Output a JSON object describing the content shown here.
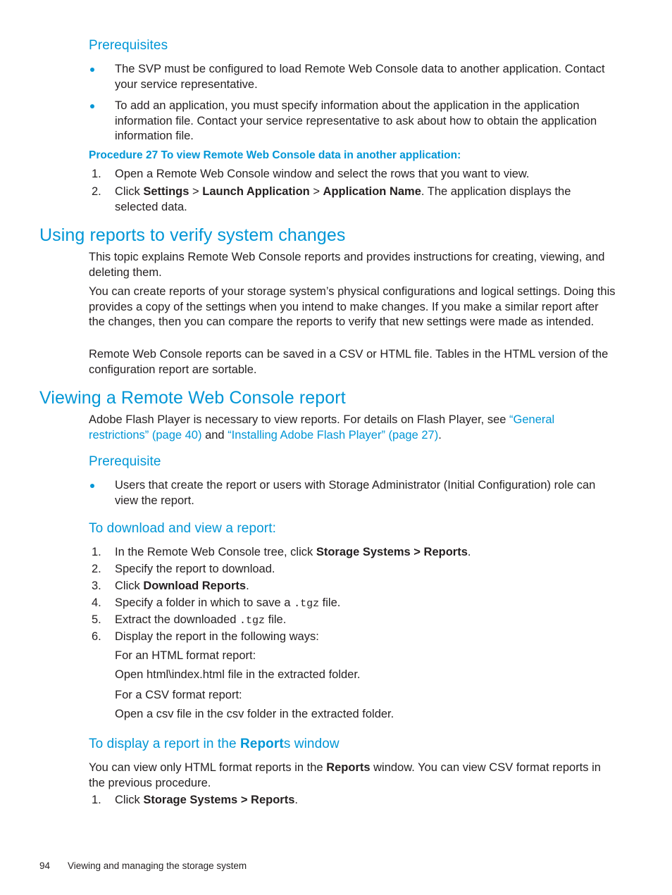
{
  "page": {
    "number": "94",
    "footer_title": "Viewing and managing the storage system"
  },
  "colors": {
    "heading_blue": "#0096d6",
    "body_text": "#231f20",
    "bullet": "#0096d6"
  },
  "sections": {
    "prerequisites_heading": "Prerequisites",
    "prereq_bullets": [
      "The SVP must be configured to load Remote Web Console data to another application. Contact your service representative.",
      "To add an application, you must specify information about the application in the application information file. Contact your service representative to ask about how to obtain the application information file."
    ],
    "procedure27_heading": "Procedure 27 To view Remote Web Console data in another application:",
    "procedure27_steps": [
      {
        "num": "1.",
        "parts": [
          {
            "t": "Open a Remote Web Console window and select the rows that you want to view.",
            "b": false
          }
        ]
      },
      {
        "num": "2.",
        "parts": [
          {
            "t": "Click ",
            "b": false
          },
          {
            "t": "Settings",
            "b": true
          },
          {
            "t": " > ",
            "b": false
          },
          {
            "t": "Launch Application",
            "b": true
          },
          {
            "t": " > ",
            "b": false
          },
          {
            "t": "Application Name",
            "b": true
          },
          {
            "t": ". The application displays the selected data.",
            "b": false
          }
        ]
      }
    ],
    "using_reports_heading": "Using reports to verify system changes",
    "using_reports_paras": [
      "This topic explains Remote Web Console reports and provides instructions for creating, viewing, and deleting them.",
      "You can create reports of your storage system’s physical configurations and logical settings. Doing this provides a copy of the settings when you intend to make changes. If you make a similar report after the changes, then you can compare the reports to verify that new settings were made as intended.",
      "Remote Web Console reports can be saved in a CSV or HTML file. Tables in the HTML version of the configuration report are sortable."
    ],
    "viewing_report_heading": "Viewing a Remote Web Console report",
    "flash_paragraph": {
      "lead": "Adobe Flash Player is necessary to view reports. For details on Flash Player, see ",
      "link1": "“General restrictions” (page 40)",
      "mid": " and ",
      "link2": "“Installing Adobe Flash Player” (page 27)",
      "tail": "."
    },
    "prerequisite_heading": "Prerequisite",
    "prerequisite_bullets": [
      "Users that create the report or users with Storage Administrator (Initial Configuration) role can view the report."
    ],
    "download_heading": "To download and view a report:",
    "download_steps": [
      {
        "num": "1.",
        "parts": [
          {
            "t": "In the Remote Web Console tree, click ",
            "b": false
          },
          {
            "t": "Storage Systems > Reports",
            "b": true
          },
          {
            "t": ".",
            "b": false
          }
        ]
      },
      {
        "num": "2.",
        "parts": [
          {
            "t": "Specify the report to download.",
            "b": false
          }
        ]
      },
      {
        "num": "3.",
        "parts": [
          {
            "t": "Click ",
            "b": false
          },
          {
            "t": "Download Reports",
            "b": true
          },
          {
            "t": ".",
            "b": false
          }
        ]
      },
      {
        "num": "4.",
        "parts": [
          {
            "t": "Specify a folder in which to save a ",
            "b": false
          },
          {
            "t": ".tgz",
            "m": true
          },
          {
            "t": " file.",
            "b": false
          }
        ]
      },
      {
        "num": "5.",
        "parts": [
          {
            "t": "Extract the downloaded ",
            "b": false
          },
          {
            "t": ".tgz",
            "m": true
          },
          {
            "t": " file.",
            "b": false
          }
        ]
      },
      {
        "num": "6.",
        "parts": [
          {
            "t": "Display the report in the following ways:",
            "b": false
          }
        ]
      }
    ],
    "download_substeps": [
      "For an HTML format report:",
      "Open html\\index.html file in the extracted folder.",
      "For a CSV format report:",
      "Open a csv file in the csv folder in the extracted folder."
    ],
    "display_heading": {
      "pre": "To display a report in the ",
      "bold": "Report",
      "post": "s window"
    },
    "display_paragraph": {
      "p1": "You can view only HTML format reports in the ",
      "b1": "Reports",
      "p2": " window. You can view CSV format reports in the previous procedure."
    },
    "display_steps": [
      {
        "num": "1.",
        "parts": [
          {
            "t": "Click ",
            "b": false
          },
          {
            "t": "Storage Systems > Reports",
            "b": true
          },
          {
            "t": ".",
            "b": false
          }
        ]
      }
    ]
  }
}
